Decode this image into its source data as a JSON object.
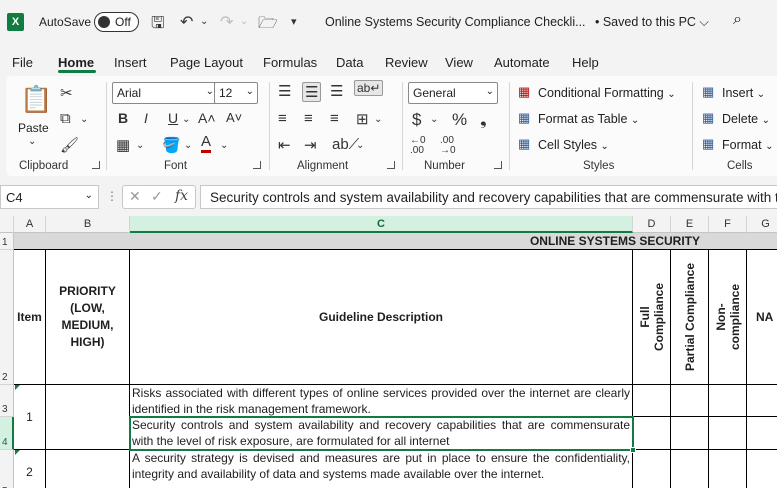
{
  "titlebar": {
    "logo": "X",
    "autosave_label": "AutoSave",
    "autosave_state": "Off",
    "doc_title": "Online Systems Security Compliance Checkli...",
    "saved_status": "•  Saved to this PC  ⌵"
  },
  "tabs": [
    "File",
    "Home",
    "Insert",
    "Page Layout",
    "Formulas",
    "Data",
    "Review",
    "View",
    "Automate",
    "Help"
  ],
  "ribbon": {
    "clipboard": {
      "label": "Clipboard",
      "paste": "Paste"
    },
    "font": {
      "label": "Font",
      "name": "Arial",
      "size": "12"
    },
    "alignment": {
      "label": "Alignment"
    },
    "number": {
      "label": "Number",
      "format": "General"
    },
    "styles": {
      "label": "Styles",
      "conditional": "Conditional Formatting",
      "format_table": "Format as Table",
      "cell_styles": "Cell Styles"
    },
    "cells": {
      "label": "Cells",
      "insert": "Insert",
      "delete": "Delete",
      "format": "Format"
    }
  },
  "formula_bar": {
    "name_box": "C4",
    "fx": "fx",
    "formula": "Security controls and system availability and recovery capabilities that are commensurate with the level of risk exposure, are formulated for all internet"
  },
  "sheet": {
    "columns": [
      "A",
      "B",
      "C",
      "D",
      "E",
      "F",
      "G"
    ],
    "rows": [
      "1",
      "2",
      "3",
      "4",
      "5"
    ],
    "title": "ONLINE SYSTEMS SECURITY",
    "headers": {
      "item": "Item",
      "priority": "PRIORITY (LOW, MEDIUM, HIGH)",
      "description": "Guideline Description",
      "full": "Full Compliance",
      "partial": "Partial Compliance",
      "non": "Non-compliance",
      "na": "NA"
    },
    "items": [
      {
        "item": "1",
        "lines": [
          "Risks associated with different types of online services provided over the internet are clearly identified in the risk management framework.",
          "Security controls and system availability and recovery capabilities that are commensurate with the level of risk exposure, are formulated for all internet"
        ]
      },
      {
        "item": "2",
        "lines": [
          "A security strategy is devised and measures are put in place to ensure the confidentiality, integrity and availability of data and systems made available over the internet."
        ]
      }
    ]
  }
}
